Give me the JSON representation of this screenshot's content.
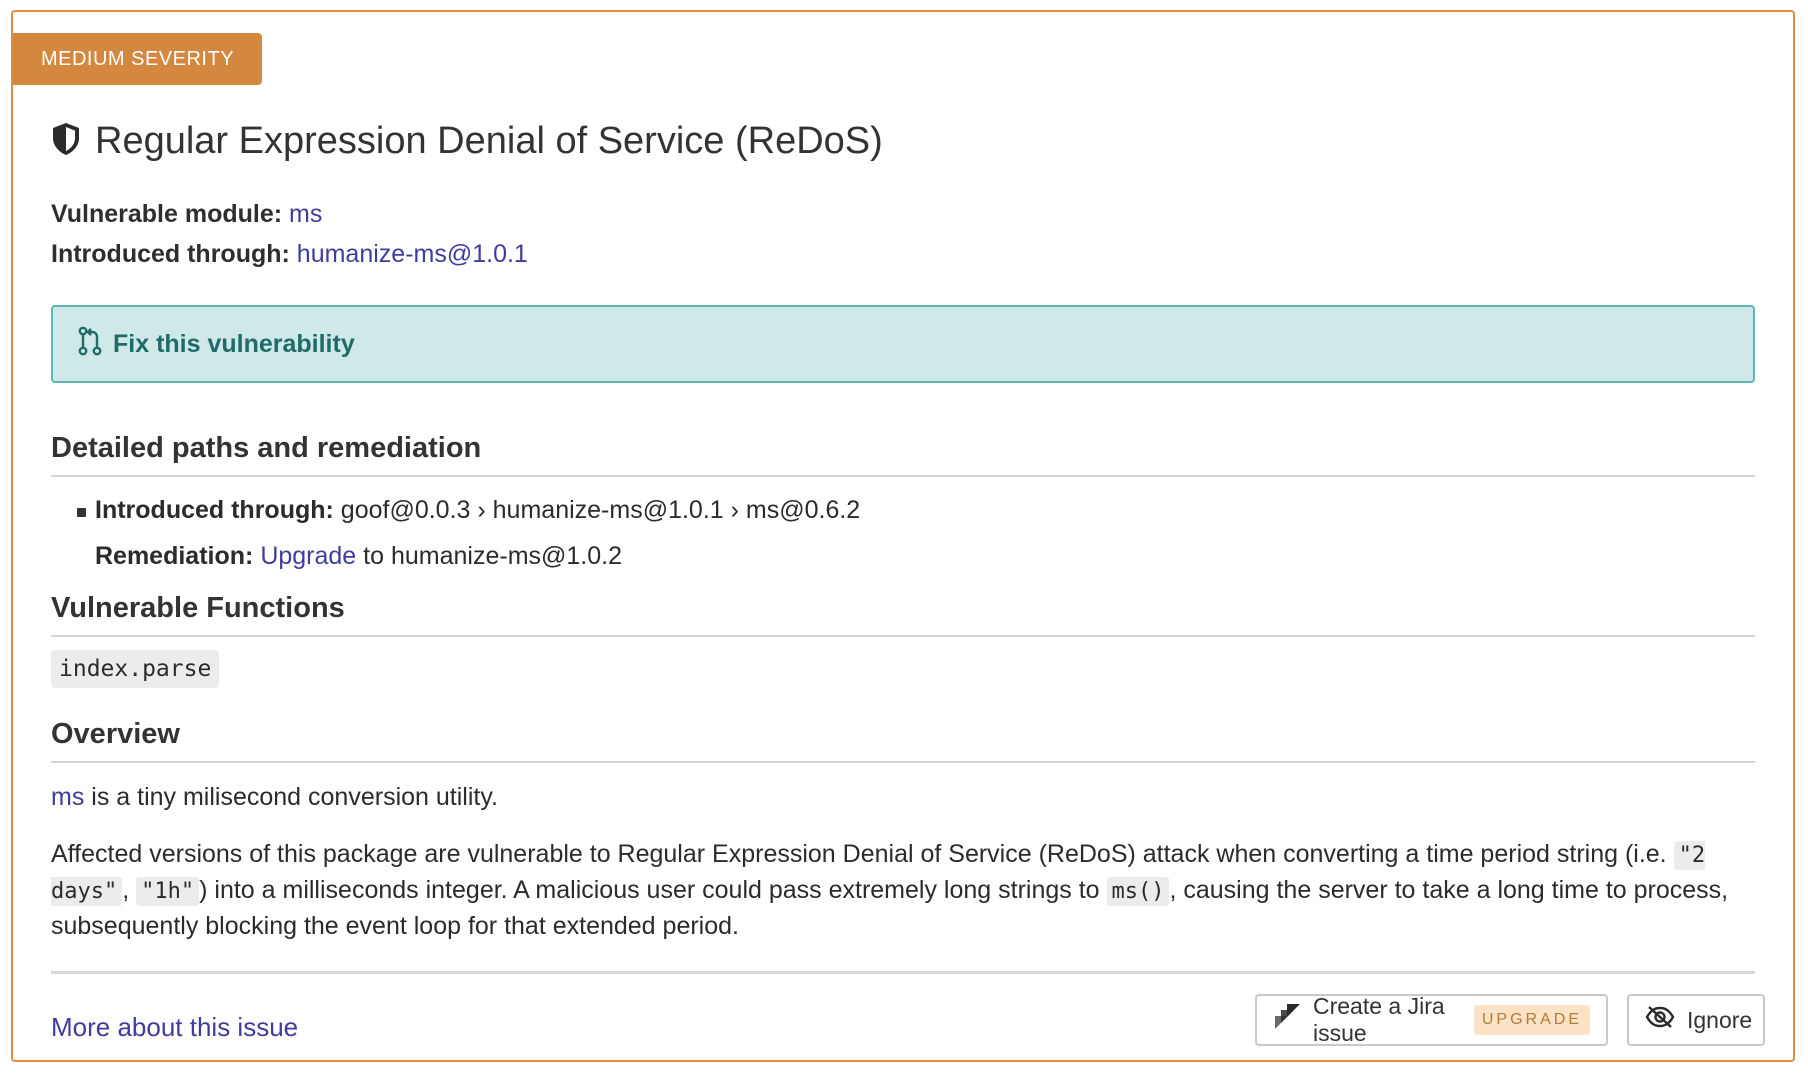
{
  "severity": "MEDIUM SEVERITY",
  "title": "Regular Expression Denial of Service (ReDoS)",
  "vulnerable_module": {
    "label": "Vulnerable module:",
    "value": "ms"
  },
  "introduced_through": {
    "label": "Introduced through:",
    "value": "humanize-ms@1.0.1"
  },
  "fix": {
    "label": "Fix this vulnerability",
    "icon": "pull-request-icon"
  },
  "detailed": {
    "heading": "Detailed paths and remediation",
    "path_label": "Introduced through:",
    "path_value": "goof@0.0.3 › humanize-ms@1.0.1 › ms@0.6.2",
    "remediation_label": "Remediation:",
    "remediation_link": "Upgrade",
    "remediation_rest": "to humanize-ms@1.0.2"
  },
  "functions": {
    "heading": "Vulnerable Functions",
    "items": [
      "index.parse"
    ]
  },
  "overview": {
    "heading": "Overview",
    "p1_link": "ms",
    "p1_rest": "is a tiny milisecond conversion utility.",
    "p2_a": "Affected versions of this package are vulnerable to Regular Expression Denial of Service (ReDoS) attack when converting a time period string (i.e. ",
    "p2_code1": "\"2 days\"",
    "p2_b": ", ",
    "p2_code2": "\"1h\"",
    "p2_c": ") into a milliseconds integer. A malicious user could pass extremely long strings to ",
    "p2_code3": "ms()",
    "p2_d": ", causing the server to take a long time to process, subsequently blocking the event loop for that extended period."
  },
  "footer": {
    "more_link": "More about this issue",
    "jira_label": "Create a Jira issue",
    "upgrade_badge": "UPGRADE",
    "ignore_label": "Ignore"
  },
  "colors": {
    "accent": "#d4883f",
    "link": "#3f3d9c",
    "fix_bg": "#cfe8e8",
    "fix_text": "#1f6b68"
  }
}
